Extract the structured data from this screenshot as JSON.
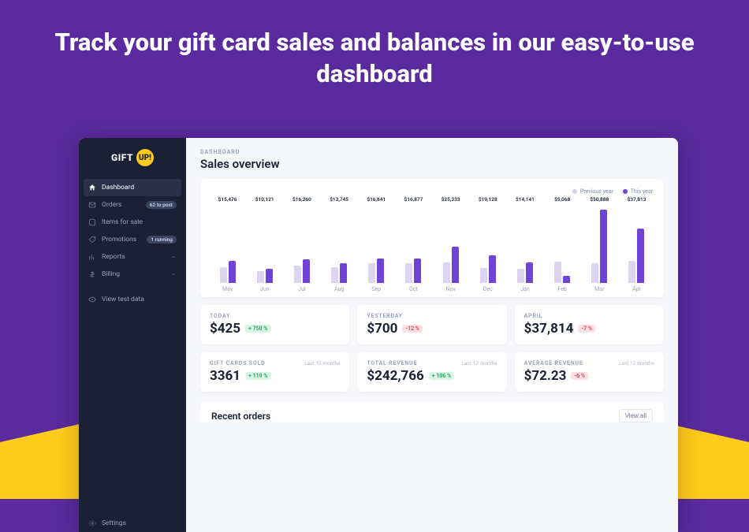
{
  "headline": "Track your gift card sales and balances in our easy-to-use dashboard",
  "logo": {
    "left": "GIFT",
    "right": "UP!"
  },
  "sidebar": {
    "items": [
      {
        "label": "Dashboard"
      },
      {
        "label": "Orders",
        "badge": "62 to post"
      },
      {
        "label": "Items for sale"
      },
      {
        "label": "Promotions",
        "badge": "1 running"
      },
      {
        "label": "Reports"
      },
      {
        "label": "Billing"
      }
    ],
    "view_test": "View test data",
    "settings": "Settings"
  },
  "main": {
    "crumb": "DASHBOARD",
    "title": "Sales overview",
    "legend": {
      "prev": "Previous year",
      "curr": "This year"
    },
    "recent_title": "Recent orders",
    "view_all": "View all"
  },
  "chart_data": {
    "type": "bar",
    "title": "Sales overview",
    "xlabel": "",
    "ylabel": "",
    "ylim": [
      0,
      55000
    ],
    "categories": [
      "May",
      "Jun",
      "Jul",
      "Aug",
      "Sep",
      "Oct",
      "Nov",
      "Dec",
      "Jan",
      "Feb",
      "Mar",
      "Apr"
    ],
    "series": [
      {
        "name": "Previous year",
        "values": [
          11000,
          8500,
          12000,
          11000,
          13500,
          14000,
          14500,
          10500,
          10000,
          15000,
          14000,
          15500
        ]
      },
      {
        "name": "This year",
        "values": [
          15476,
          10121,
          16260,
          13745,
          16841,
          16877,
          25333,
          19128,
          14141,
          5068,
          50888,
          37813
        ]
      }
    ],
    "value_labels": [
      "$15,476",
      "$10,121",
      "$16,260",
      "$13,745",
      "$16,841",
      "$16,877",
      "$25,333",
      "$19,128",
      "$14,141",
      "$5,068",
      "$50,888",
      "$37,813"
    ]
  },
  "stats_top": [
    {
      "label": "TODAY",
      "value": "$425",
      "delta": "+ 750 %",
      "dir": "up"
    },
    {
      "label": "YESTERDAY",
      "value": "$700",
      "delta": "-12 %",
      "dir": "down"
    },
    {
      "label": "APRIL",
      "value": "$37,814",
      "delta": "-7 %",
      "dir": "down"
    }
  ],
  "stats_bottom": [
    {
      "label": "GIFT CARDS SOLD",
      "note": "Last 12 months",
      "value": "3361",
      "delta": "+ 119 %",
      "dir": "up"
    },
    {
      "label": "TOTAL REVENUE",
      "note": "Last 12 months",
      "value": "$242,766",
      "delta": "+ 106 %",
      "dir": "up"
    },
    {
      "label": "AVERAGE REVENUE",
      "note": "Last 12 months",
      "value": "$72.23",
      "delta": "-6 %",
      "dir": "down"
    }
  ]
}
